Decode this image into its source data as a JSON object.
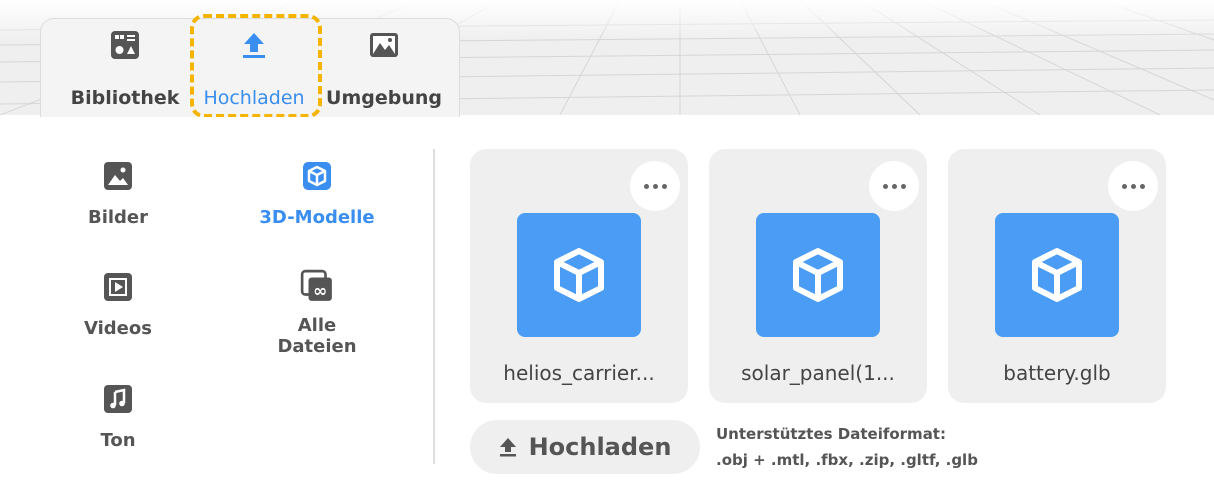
{
  "tabs": [
    {
      "label": "Bibliothek",
      "icon": "library-icon",
      "active": false
    },
    {
      "label": "Hochladen",
      "icon": "upload-icon",
      "active": true
    },
    {
      "label": "Umgebung",
      "icon": "environment-image-icon",
      "active": false
    }
  ],
  "categories": [
    {
      "label": "Bilder",
      "icon": "image-icon",
      "active": false
    },
    {
      "label": "3D-Modelle",
      "icon": "cube-icon",
      "active": true
    },
    {
      "label": "Videos",
      "icon": "video-icon",
      "active": false
    },
    {
      "label": "Alle Dateien",
      "icon": "all-files-icon",
      "active": false
    },
    {
      "label": "Ton",
      "icon": "music-note-icon",
      "active": false
    }
  ],
  "files": [
    {
      "name": "helios_carrier...",
      "icon": "cube-icon"
    },
    {
      "name": "solar_panel(1...",
      "icon": "cube-icon"
    },
    {
      "name": "battery.glb",
      "icon": "cube-icon"
    }
  ],
  "upload": {
    "label": "Hochladen",
    "icon": "upload-arrow-icon"
  },
  "formats": {
    "title": "Unterstütztes Dateiformat:",
    "list": ".obj + .mtl, .fbx, .zip, .gltf, .glb"
  },
  "colors": {
    "accent": "#3a8ef0",
    "thumb": "#4a9cf5",
    "highlight": "#f5b400",
    "icon_gray": "#555555"
  }
}
